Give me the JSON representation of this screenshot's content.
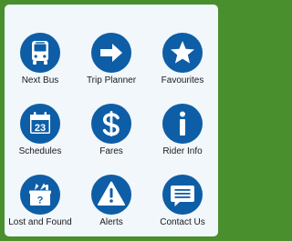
{
  "colors": {
    "outer_frame": "#4a8f2e",
    "panel_background": "#f2f7fc",
    "icon_circle": "#0d5ea6",
    "icon_glyph": "#ffffff",
    "label_text": "#1a1a1a"
  },
  "menu": {
    "items": [
      {
        "label": "Next Bus",
        "icon": "bus-icon"
      },
      {
        "label": "Trip Planner",
        "icon": "arrow-right-icon"
      },
      {
        "label": "Favourites",
        "icon": "star-icon"
      },
      {
        "label": "Schedules",
        "icon": "calendar-icon"
      },
      {
        "label": "Fares",
        "icon": "dollar-icon"
      },
      {
        "label": "Rider Info",
        "icon": "info-icon"
      },
      {
        "label": "Lost and Found",
        "icon": "lost-box-icon"
      },
      {
        "label": "Alerts",
        "icon": "warning-icon"
      },
      {
        "label": "Contact Us",
        "icon": "message-icon"
      }
    ],
    "calendar_day": "23",
    "lost_box_mark": "?"
  }
}
